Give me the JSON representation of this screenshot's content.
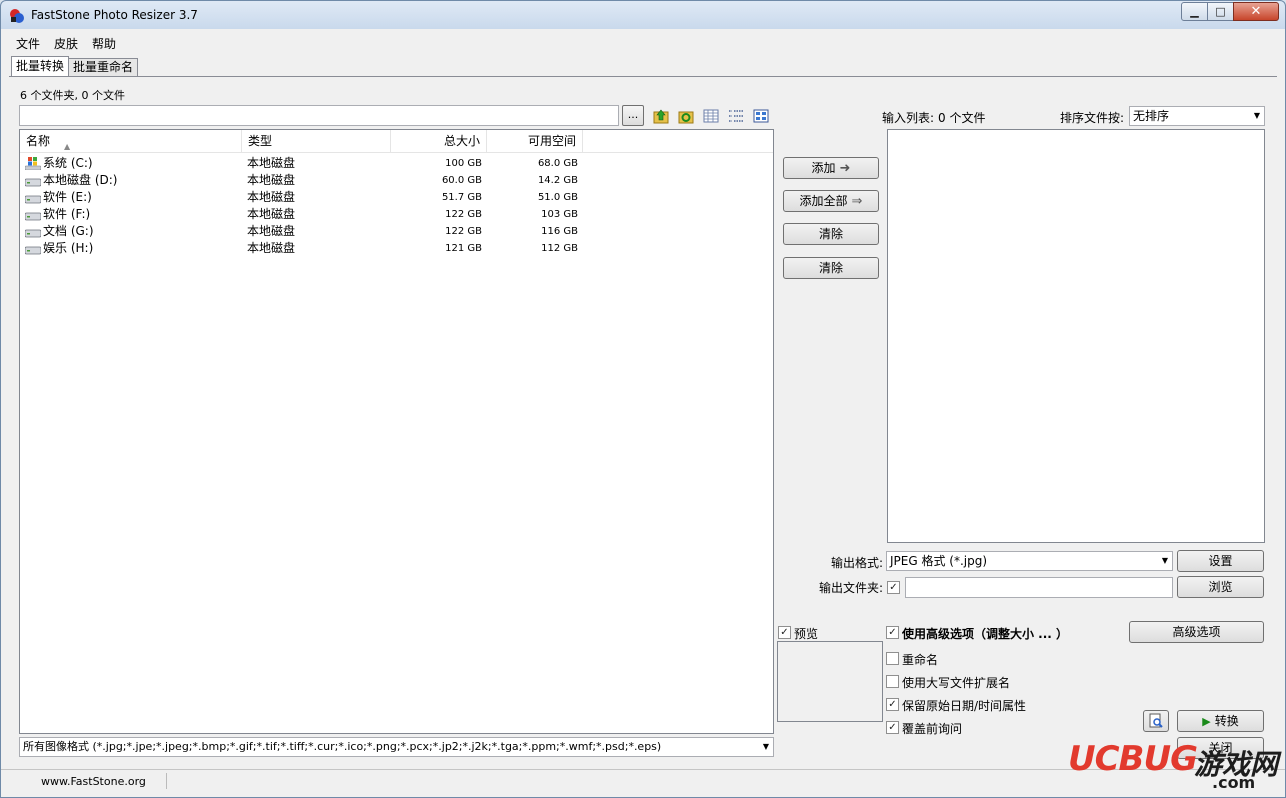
{
  "window": {
    "title": "FastStone Photo Resizer 3.7"
  },
  "menu": [
    "文件",
    "皮肤",
    "帮助"
  ],
  "tabs": [
    "批量转换",
    "批量重命名"
  ],
  "folder_status": "6 个文件夹, 0 个文件",
  "path": {
    "value": "",
    "browse_label": "..."
  },
  "toolbar_icons": [
    "folder-up-icon",
    "refresh-icon",
    "details-view-icon",
    "list-view-icon",
    "thumbnail-view-icon"
  ],
  "file_list": {
    "columns": [
      "名称",
      "类型",
      "总大小",
      "可用空间"
    ],
    "rows": [
      {
        "name": "系统 (C:)",
        "type": "本地磁盘",
        "total": "100 GB",
        "free": "68.0 GB"
      },
      {
        "name": "本地磁盘 (D:)",
        "type": "本地磁盘",
        "total": "60.0 GB",
        "free": "14.2 GB"
      },
      {
        "name": "软件 (E:)",
        "type": "本地磁盘",
        "total": "51.7 GB",
        "free": "51.0 GB"
      },
      {
        "name": "软件 (F:)",
        "type": "本地磁盘",
        "total": "122 GB",
        "free": "103 GB"
      },
      {
        "name": "文档 (G:)",
        "type": "本地磁盘",
        "total": "122 GB",
        "free": "116 GB"
      },
      {
        "name": "娱乐 (H:)",
        "type": "本地磁盘",
        "total": "121 GB",
        "free": "112 GB"
      }
    ]
  },
  "filter": "所有图像格式 (*.jpg;*.jpe;*.jpeg;*.bmp;*.gif;*.tif;*.tiff;*.cur;*.ico;*.png;*.pcx;*.jp2;*.j2k;*.tga;*.ppm;*.wmf;*.psd;*.eps)",
  "actions": {
    "add": "添加",
    "add_all": "添加全部",
    "remove": "清除",
    "clear": "清除"
  },
  "input_list": {
    "label": "输入列表:",
    "count": "0 个文件",
    "sort_label": "排序文件按:",
    "sort_value": "无排序"
  },
  "output": {
    "format_label": "输出格式:",
    "format_value": "JPEG 格式 (*.jpg)",
    "settings": "设置",
    "folder_label": "输出文件夹:",
    "folder_value": "",
    "browse": "浏览"
  },
  "preview_label": "预览",
  "options": {
    "advanced": "使用高级选项（调整大小 ... ）",
    "advanced_button": "高级选项",
    "rename": "重命名",
    "uppercase_ext": "使用大写文件扩展名",
    "keep_date": "保留原始日期/时间属性",
    "overwrite_prompt": "覆盖前询问"
  },
  "convert": "转换",
  "close": "关闭",
  "statusbar": {
    "url": "www.FastStone.org"
  },
  "watermark": {
    "brand": "UCBUG",
    "game": "游戏网",
    "domain": ".com"
  },
  "colors": {
    "accent": "#1a8a1a",
    "watermark_red": "#e23a2e"
  }
}
